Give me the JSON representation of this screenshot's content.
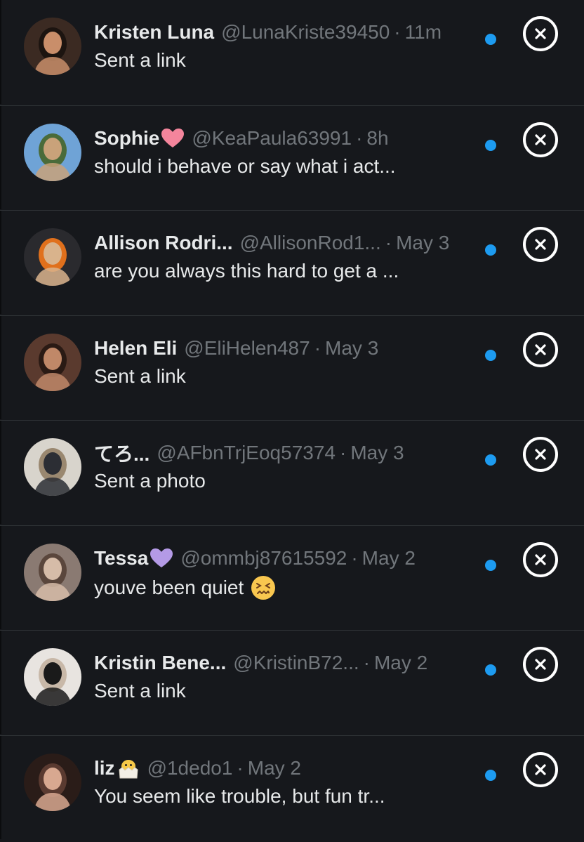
{
  "conversations": [
    {
      "name": "Kristen Luna",
      "badge": "",
      "handle": "@LunaKriste39450",
      "separator": "·",
      "time": "11m",
      "preview": "Sent a link",
      "preview_emoji": "",
      "unread": true,
      "avatar_icon": "avatar-photo",
      "avatar_colors": [
        "#3b2a22",
        "#c98e6a",
        "#1c1410"
      ]
    },
    {
      "name": "Sophie",
      "badge": "pink-heart-emoji",
      "handle": "@KeaPaula63991",
      "separator": "·",
      "time": "8h",
      "preview": "should i behave or say what i act...",
      "preview_emoji": "",
      "unread": true,
      "avatar_icon": "avatar-photo",
      "avatar_colors": [
        "#6fa3d6",
        "#c9a27a",
        "#4a6b3a"
      ]
    },
    {
      "name": "Allison Rodri...",
      "badge": "",
      "handle": "@AllisonRod1...",
      "separator": "·",
      "time": "May 3",
      "preview": "are you always this hard to get a ...",
      "preview_emoji": "",
      "unread": true,
      "avatar_icon": "avatar-photo",
      "avatar_colors": [
        "#2a2a2e",
        "#d9b38c",
        "#e0701c"
      ]
    },
    {
      "name": "Helen Eli",
      "badge": "",
      "handle": "@EliHelen487",
      "separator": "·",
      "time": "May 3",
      "preview": "Sent a link",
      "preview_emoji": "",
      "unread": true,
      "avatar_icon": "avatar-photo",
      "avatar_colors": [
        "#5a3a2e",
        "#c08868",
        "#2a1a14"
      ]
    },
    {
      "name": "てろ...",
      "badge": "",
      "handle": "@AFbnTrjEoq57374",
      "separator": "·",
      "time": "May 3",
      "preview": "Sent a photo",
      "preview_emoji": "",
      "unread": true,
      "avatar_icon": "avatar-photo",
      "avatar_colors": [
        "#d8d4cc",
        "#2c2e34",
        "#9a8870"
      ]
    },
    {
      "name": "Tessa",
      "badge": "purple-heart-emoji",
      "handle": "@ommbj87615592",
      "separator": "·",
      "time": "May 2",
      "preview": "youve been quiet",
      "preview_emoji": "confounded-face-emoji",
      "unread": true,
      "avatar_icon": "avatar-photo",
      "avatar_colors": [
        "#8a7a72",
        "#d6bca8",
        "#5a463c"
      ]
    },
    {
      "name": "Kristin Bene...",
      "badge": "",
      "handle": "@KristinB72...",
      "separator": "·",
      "time": "May 2",
      "preview": "Sent a link",
      "preview_emoji": "",
      "unread": true,
      "avatar_icon": "avatar-photo",
      "avatar_colors": [
        "#e8e4e0",
        "#1a1a1a",
        "#c8b8a8"
      ]
    },
    {
      "name": "liz",
      "badge": "hatching-chick-emoji",
      "handle": "@1dedo1",
      "separator": "·",
      "time": "May 2",
      "preview": "You seem like trouble, but fun tr...",
      "preview_emoji": "",
      "unread": true,
      "avatar_icon": "avatar-photo",
      "avatar_colors": [
        "#2a1c18",
        "#d8a890",
        "#5a3a30"
      ]
    }
  ],
  "colors": {
    "background": "#16181c",
    "divider": "#2f3336",
    "primary_text": "#e7e9ea",
    "secondary_text": "#71767b",
    "unread_dot": "#1d9bf0",
    "close_icon": "#ffffff"
  },
  "icons": {
    "dismiss": "close-circle-icon",
    "unread": "unread-dot-icon"
  }
}
